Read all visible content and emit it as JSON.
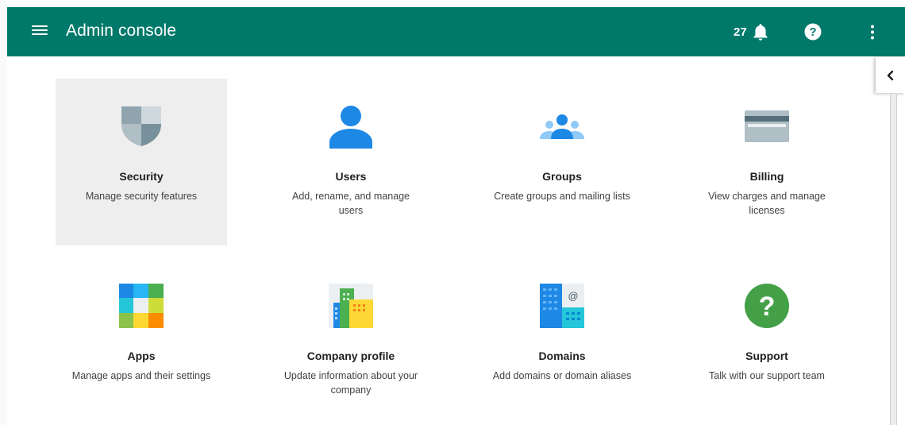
{
  "header": {
    "title": "Admin console",
    "notification_count": "27",
    "icons": [
      "menu-icon",
      "bell-icon",
      "help-icon",
      "more-vert-icon"
    ],
    "background": "#00796b"
  },
  "side_panel": {
    "toggle_icon": "chevron-left-icon"
  },
  "cards": [
    {
      "title": "Security",
      "desc": "Manage security features",
      "icon": "shield-icon",
      "selected": true
    },
    {
      "title": "Users",
      "desc": "Add, rename, and manage users",
      "icon": "person-icon"
    },
    {
      "title": "Groups",
      "desc": "Create groups and mailing lists",
      "icon": "groups-icon"
    },
    {
      "title": "Billing",
      "desc": "View charges and manage licenses",
      "icon": "credit-card-icon"
    },
    {
      "title": "Apps",
      "desc": "Manage apps and their settings",
      "icon": "apps-grid-icon"
    },
    {
      "title": "Company profile",
      "desc": "Update information about your company",
      "icon": "buildings-icon"
    },
    {
      "title": "Domains",
      "desc": "Add domains or domain aliases",
      "icon": "domain-icon"
    },
    {
      "title": "Support",
      "desc": "Talk with our support team",
      "icon": "question-circle-icon"
    }
  ]
}
